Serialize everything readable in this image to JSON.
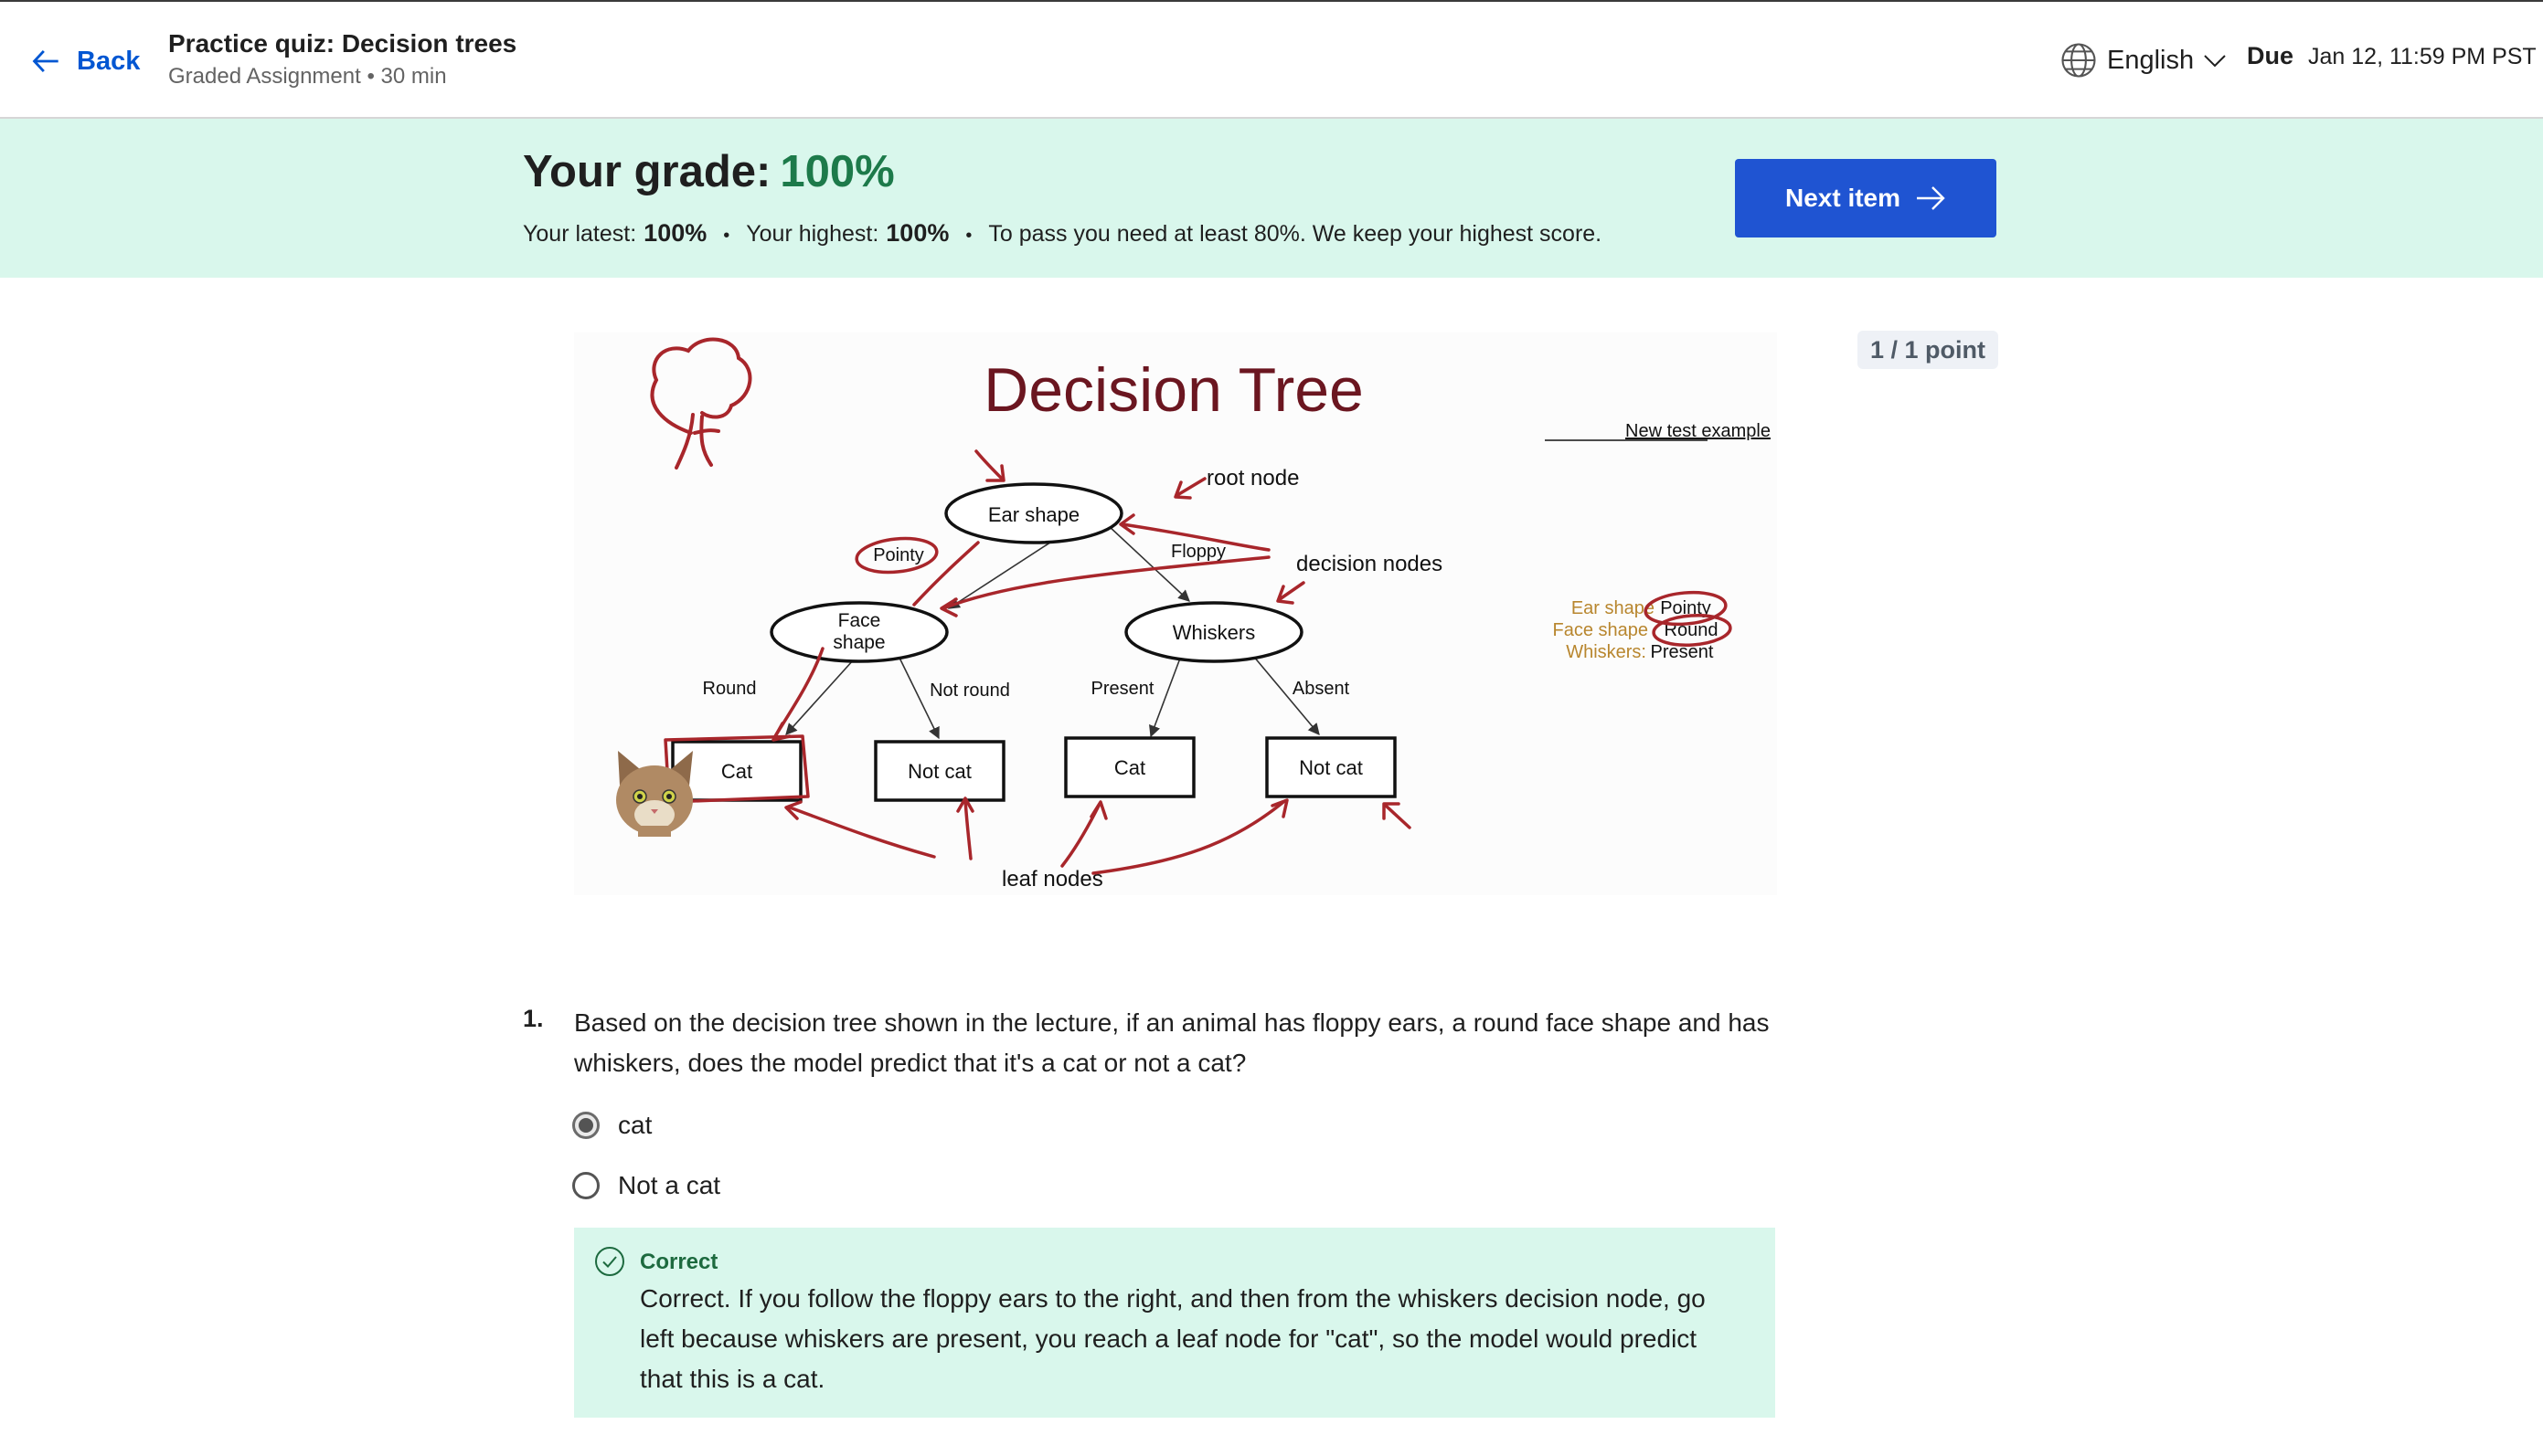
{
  "header": {
    "back_label": "Back",
    "title": "Practice quiz: Decision trees",
    "subtitle": "Graded Assignment • 30 min",
    "language": "English",
    "due_label": "Due",
    "due_date": "Jan 12, 11:59 PM PST"
  },
  "grade": {
    "label": "Your grade:",
    "value": "100%",
    "latest_label": "Your latest:",
    "latest_value": "100%",
    "highest_label": "Your highest:",
    "highest_value": "100%",
    "pass_note": "To pass you need at least 80%. We keep your highest score.",
    "next_button": "Next item"
  },
  "points": "1 / 1 point",
  "diagram": {
    "title": "Decision Tree",
    "new_example": "New test example",
    "root_note": "root node",
    "decision_note": "decision nodes",
    "leaf_note": "leaf nodes",
    "nodes": {
      "ear": "Ear shape",
      "face_line1": "Face",
      "face_line2": "shape",
      "whiskers": "Whiskers",
      "leaf1": "Cat",
      "leaf2": "Not cat",
      "leaf3": "Cat",
      "leaf4": "Not cat"
    },
    "edges": {
      "pointy": "Pointy",
      "floppy": "Floppy",
      "round": "Round",
      "not_round": "Not round",
      "present": "Present",
      "absent": "Absent"
    },
    "example": {
      "ear_label": "Ear shape",
      "ear_value": "Pointy",
      "face_label": "Face shape",
      "face_value": "Round",
      "whiskers_label": "Whiskers:",
      "whiskers_value": "Present"
    },
    "colors": {
      "annotation": "#a8262b",
      "example_text": "#b8862e"
    }
  },
  "question": {
    "number": "1.",
    "text": "Based on the decision tree shown in the lecture, if an animal has floppy ears, a round face shape and has whiskers, does the model predict that it's a cat or not a cat?",
    "options": [
      {
        "label": "cat",
        "selected": true
      },
      {
        "label": "Not a cat",
        "selected": false
      }
    ]
  },
  "feedback": {
    "title": "Correct",
    "text": "Correct. If you follow the floppy ears to the right, and then from the whiskers decision node, go left because whiskers are present, you reach a leaf node for \"cat\", so the model would predict that this is a cat."
  },
  "colors": {
    "accent": "#1f54d2",
    "success_bg": "#d9f7ec",
    "success_text": "#1d7a4a"
  }
}
